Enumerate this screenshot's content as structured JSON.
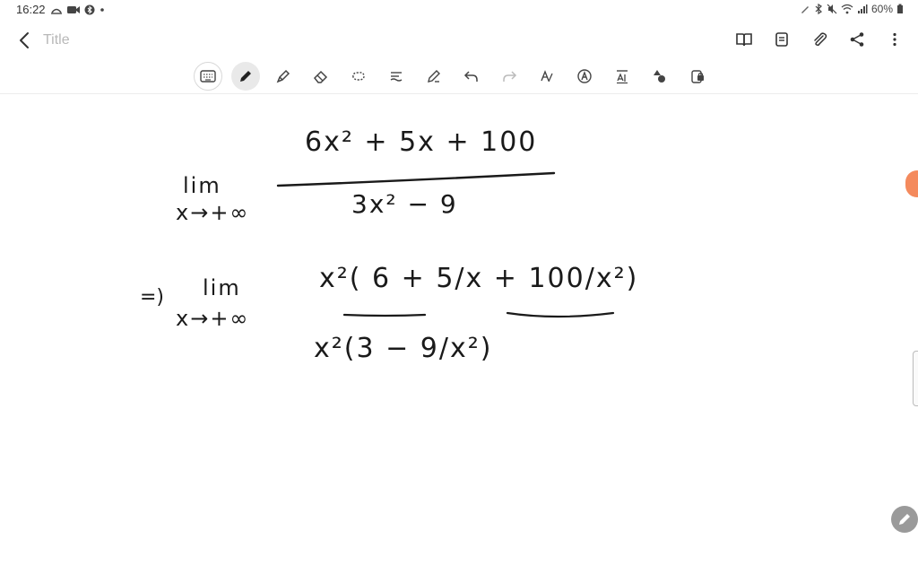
{
  "status": {
    "time": "16:22",
    "battery": "60%",
    "left_icons": [
      "weather-icon",
      "video-icon",
      "bluetooth-icon",
      "dot-icon"
    ],
    "right_icons": [
      "pen-icon",
      "bluetooth-icon",
      "mute-icon",
      "wifi-icon",
      "signal-icon",
      "battery-icon"
    ]
  },
  "title": {
    "placeholder": "Title"
  },
  "title_actions": [
    "book-icon",
    "note-icon",
    "attach-icon",
    "share-icon",
    "more-icon"
  ],
  "toolbar": {
    "tools": [
      "keyboard-icon",
      "pen-icon",
      "highlighter-icon",
      "eraser-icon",
      "lasso-icon",
      "text-convert-icon",
      "pen-settings-icon",
      "undo-icon",
      "redo-icon",
      "handwriting-icon",
      "text-icon",
      "font-size-icon",
      "shapes-icon",
      "lock-icon"
    ],
    "active_tool": "pen-icon"
  },
  "handwriting": {
    "numerator1": "6x² + 5x + 100",
    "lim1": "lim",
    "sub1": "x→+∞",
    "denominator1": "3x² − 9",
    "implies": "=)",
    "lim2": "lim",
    "sub2": "x→+∞",
    "numerator2": "x²( 6 + 5/x + 100/x²)",
    "denominator2": "x²(3 − 9/x²)"
  },
  "colors": {
    "accent_dot": "#f48a5d",
    "ink": "#1a1a1a"
  }
}
